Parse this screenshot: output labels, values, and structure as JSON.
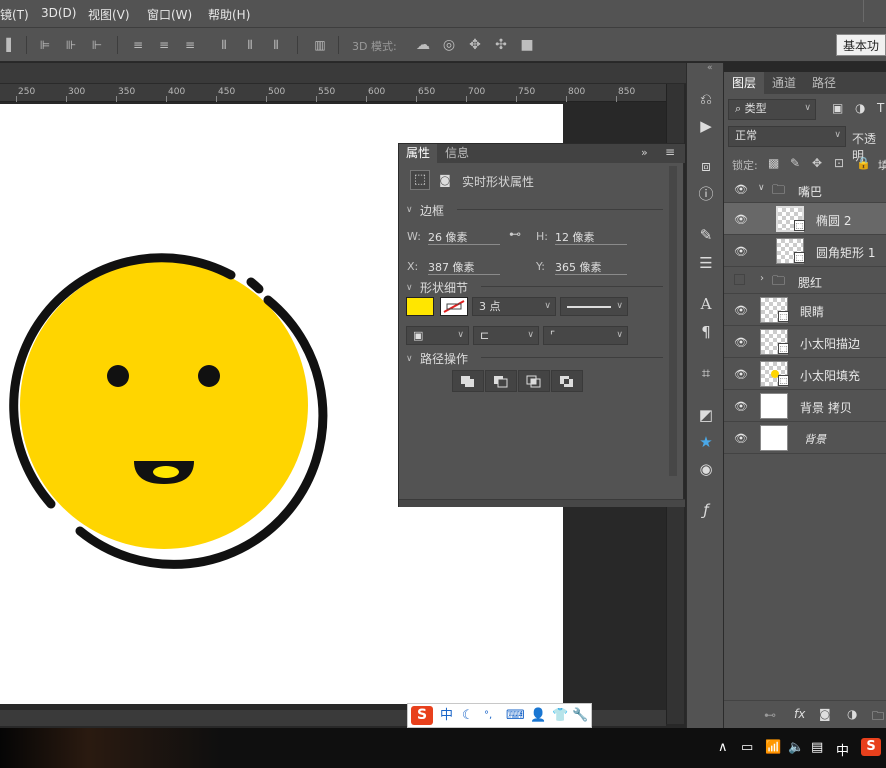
{
  "menubar": {
    "items": [
      "镜(T)",
      "3D(D)",
      "视图(V)",
      "窗口(W)",
      "帮助(H)"
    ]
  },
  "optionsbar": {
    "mode_3d_label": "3D 模式:",
    "workspace": "基本功"
  },
  "ruler": {
    "ticks": [
      "250",
      "300",
      "350",
      "400",
      "450",
      "500",
      "550",
      "600",
      "650",
      "700",
      "750",
      "800",
      "850"
    ]
  },
  "properties": {
    "tabs": [
      "属性",
      "信息"
    ],
    "header": "实时形状属性",
    "sections": {
      "bbox": "边框",
      "shape": "形状细节",
      "path": "路径操作"
    },
    "w_label": "W:",
    "w_value": "26 像素",
    "h_label": "H:",
    "h_value": "12 像素",
    "x_label": "X:",
    "x_value": "387 像素",
    "y_label": "Y:",
    "y_value": "365 像素",
    "stroke_width": "3 点",
    "fill_color": "#ffe600"
  },
  "layers_panel": {
    "tabs": [
      "图层",
      "通道",
      "路径"
    ],
    "filter": "类型",
    "blend": "正常",
    "opacity_label": "不透明",
    "lock_label": "锁定:",
    "fill_label": "填",
    "layers": [
      {
        "name": "嘴巴",
        "type": "group",
        "expanded": true,
        "visible": true
      },
      {
        "name": "椭圆 2",
        "type": "shape",
        "selected": true,
        "visible": true
      },
      {
        "name": "圆角矩形 1",
        "type": "shape",
        "visible": true
      },
      {
        "name": "腮红",
        "type": "group",
        "expanded": false,
        "visible": false
      },
      {
        "name": "眼睛",
        "type": "shape",
        "visible": true
      },
      {
        "name": "小太阳描边",
        "type": "shape",
        "visible": true
      },
      {
        "name": "小太阳填充",
        "type": "shape",
        "visible": true
      },
      {
        "name": "背景 拷贝",
        "type": "pixel",
        "visible": true
      },
      {
        "name": "背景",
        "type": "pixel",
        "visible": true
      }
    ]
  },
  "canvas": {
    "face_color": "#ffd500",
    "outline_color": "#111111"
  },
  "ime": {
    "items": [
      "中"
    ]
  },
  "taskbar": {
    "lang": "中"
  }
}
